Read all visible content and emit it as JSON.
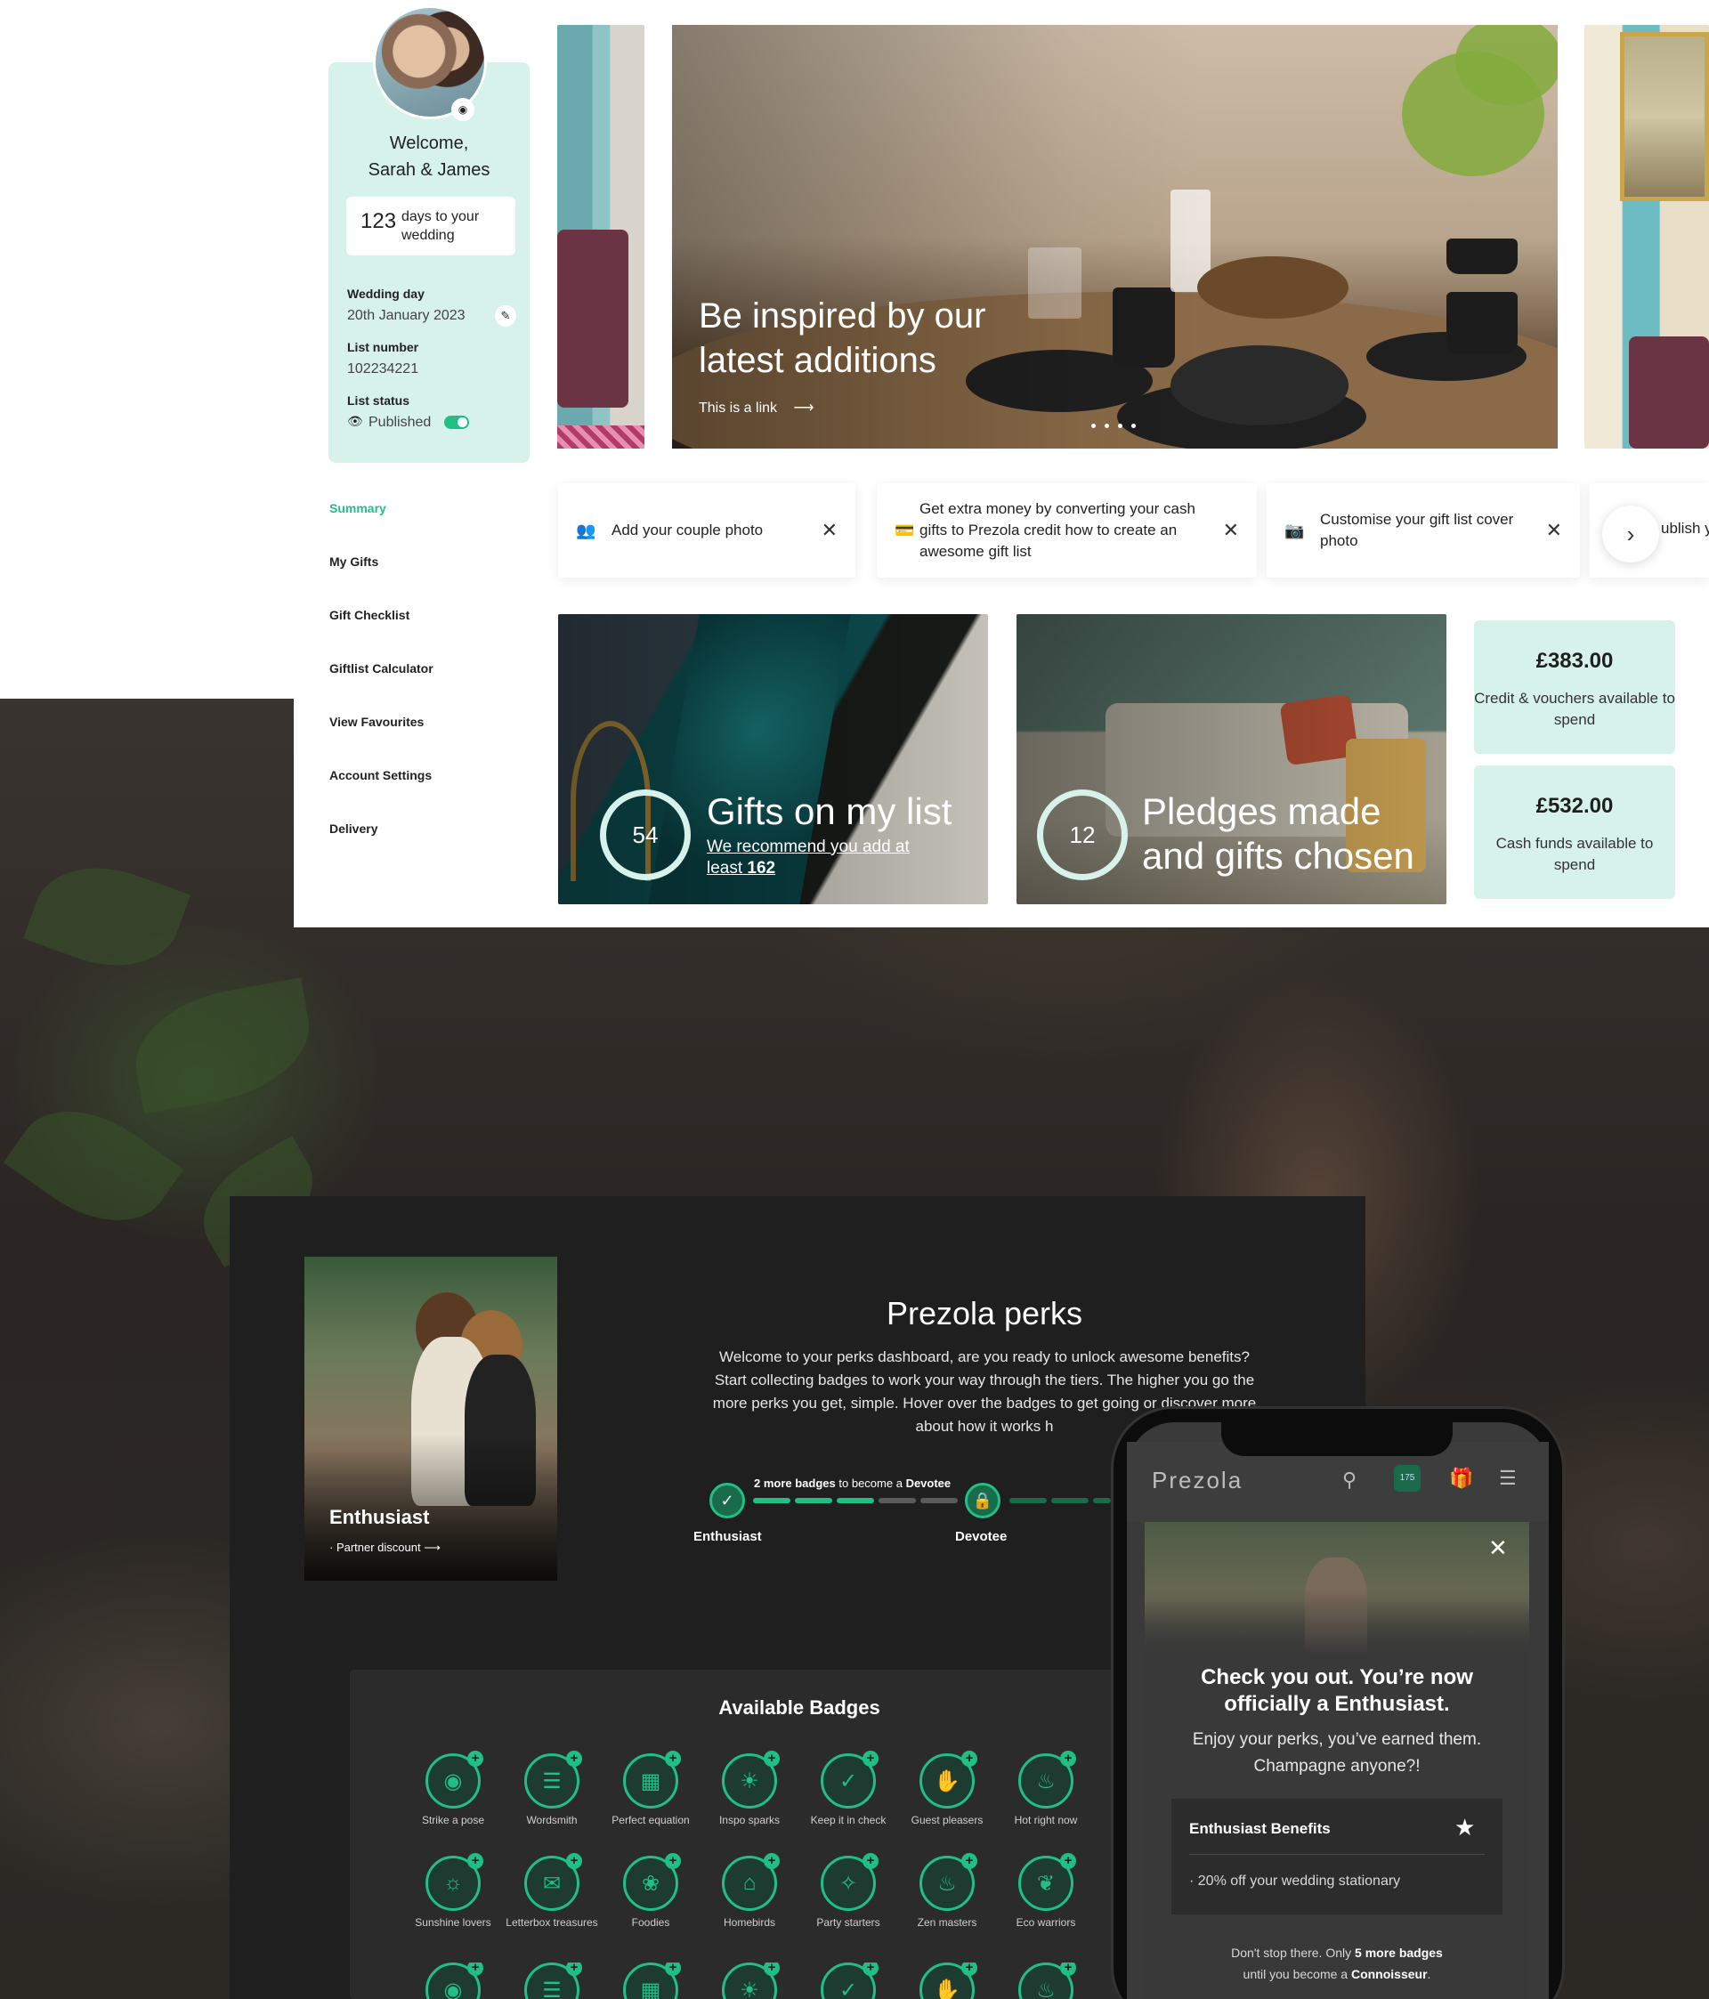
{
  "profile": {
    "welcome_line1": "Welcome,",
    "welcome_line2": "Sarah & James",
    "days_count": "123",
    "days_text": "days to your wedding",
    "wedding_day_label": "Wedding day",
    "wedding_day_value": "20th January 2023",
    "list_number_label": "List number",
    "list_number_value": "102234221",
    "list_status_label": "List status",
    "list_status_value": "Published",
    "list_status_on": true
  },
  "nav": {
    "items": [
      {
        "label": "Summary",
        "active": true
      },
      {
        "label": "My Gifts",
        "active": false
      },
      {
        "label": "Gift Checklist",
        "active": false
      },
      {
        "label": "Giftlist Calculator",
        "active": false
      },
      {
        "label": "View Favourites",
        "active": false
      },
      {
        "label": "Account Settings",
        "active": false
      },
      {
        "label": "Delivery",
        "active": false
      }
    ]
  },
  "hero": {
    "title": "Be inspired by our latest additions",
    "link_label": "This is a link",
    "link_icon": "arrow-right-icon",
    "slide_count": 4
  },
  "tasks": [
    {
      "icon": "couple-icon",
      "text": "Add your couple photo"
    },
    {
      "icon": "card-icon",
      "text": "Get extra money by converting your cash gifts to Prezola credit how to create an awesome gift list"
    },
    {
      "icon": "camera-icon",
      "text": "Customise your gift list cover photo"
    },
    {
      "icon": "none",
      "text": "ublish y"
    }
  ],
  "stats": {
    "gifts_count": "54",
    "gifts_title": "Gifts on my list",
    "gifts_sub": "We recommend you add at least",
    "gifts_sub_bold": "162",
    "pledges_count": "12",
    "pledges_title": "Pledges made and gifts chosen",
    "credit_amount": "£383.00",
    "credit_label": "Credit & vouchers available to spend",
    "cash_amount": "£532.00",
    "cash_label": "Cash funds available to spend"
  },
  "perks": {
    "card_tier": "Enthusiast",
    "card_link": "· Partner discount",
    "title": "Prezola perks",
    "body": "Welcome to your perks dashboard, are you ready to unlock awesome benefits? Start collecting badges to work your way through the tiers. The higher you go the more perks you get, simple. Hover over the badges to get going or discover more about how it works h",
    "progress_bold": "2 more badges",
    "progress_mid": "to become a",
    "progress_target": "Devotee",
    "progress_done": 3,
    "progress_total": 5,
    "tier_current": "Enthusiast",
    "tier_next": "Devotee"
  },
  "badges": {
    "title": "Available Badges",
    "row1": [
      {
        "name": "Strike a pose",
        "icon": "camera-icon"
      },
      {
        "name": "Wordsmith",
        "icon": "notebook-icon"
      },
      {
        "name": "Perfect equation",
        "icon": "calculator-icon"
      },
      {
        "name": "Inspo sparks",
        "icon": "lightbulb-icon"
      },
      {
        "name": "Keep it in check",
        "icon": "checklist-icon"
      },
      {
        "name": "Guest pleasers",
        "icon": "hands-icon"
      },
      {
        "name": "Hot right now",
        "icon": "flame-icon"
      }
    ],
    "row2": [
      {
        "name": "Sunshine lovers",
        "icon": "sun-icon"
      },
      {
        "name": "Letterbox treasures",
        "icon": "letter-icon"
      },
      {
        "name": "Foodies",
        "icon": "cupcake-icon"
      },
      {
        "name": "Homebirds",
        "icon": "sofa-icon"
      },
      {
        "name": "Party starters",
        "icon": "glasses-icon"
      },
      {
        "name": "Zen masters",
        "icon": "bath-icon"
      },
      {
        "name": "Eco warriors",
        "icon": "leaf-icon"
      }
    ]
  },
  "phone": {
    "logo": "Prezola",
    "bag_count": "175",
    "modal_heading": "Check you out. You’re now officially a Enthusiast.",
    "modal_body": "Enjoy your perks, you’ve earned them. Champagne anyone?!",
    "benefits_title": "Enthusiast Benefits",
    "benefit_item": "· 20% off your wedding stationary",
    "foot_prefix": "Don't stop there. Only",
    "foot_bold": "5 more badges",
    "foot_mid": "until you become a",
    "foot_tier": "Connoisseur",
    "foot_end": "."
  },
  "colors": {
    "accent": "#1fbf86",
    "mint": "#d7f2ea",
    "dark_panel": "#1f1f1f"
  }
}
